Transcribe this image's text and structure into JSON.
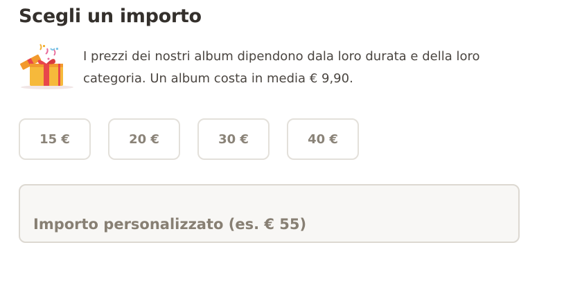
{
  "section": {
    "title": "Scegli un importo",
    "description": "I prezzi dei nostri album dipendono dala loro durata e della loro categoria. Un album costa in media € 9,90.",
    "illustration": "gift-box-icon"
  },
  "amounts": [
    {
      "label": "15 €"
    },
    {
      "label": "20 €"
    },
    {
      "label": "30 €"
    },
    {
      "label": "40 €"
    }
  ],
  "custom_amount": {
    "value": "",
    "placeholder": "Importo personalizzato (es. € 55)"
  },
  "colors": {
    "text_dark": "#34302c",
    "button_text": "#8a8378",
    "border": "#e3e0da",
    "input_bg": "#f8f7f5",
    "gift_body": "#f6b93b",
    "gift_ribbon": "#e8474b"
  }
}
